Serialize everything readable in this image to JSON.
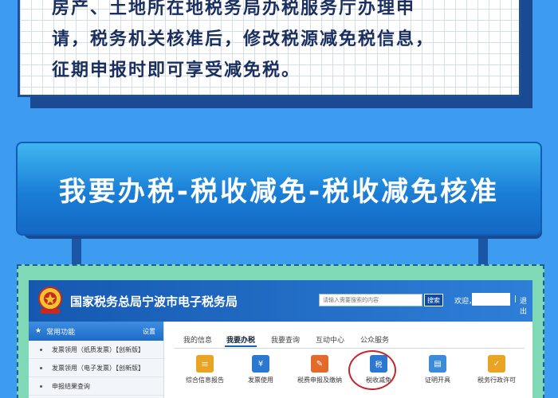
{
  "top_text": {
    "line1": "房产、土地所在地税务局办税服务厅办理申",
    "line2": "请，税务机关核准后，修改税源减免税信息，",
    "line3": "征期申报时即可享受减免税。"
  },
  "banner": {
    "title": "我要办税-税收减免-税收减免核准"
  },
  "site": {
    "title": "国家税务总局宁波市电子税务局",
    "search_placeholder": "请输入需要搜索的内容",
    "search_button": "搜索",
    "welcome": "欢迎，",
    "separator": "|",
    "logout": "退出"
  },
  "sidebar": {
    "header": "常用功能",
    "settings": "设置",
    "items": [
      "发票领用（纸质发票）【创新版】",
      "发票领用（电子发票）【创新版】",
      "申报结果查询"
    ]
  },
  "tabs": [
    "我的信息",
    "我要办税",
    "我要查询",
    "互动中心",
    "公众服务"
  ],
  "tiles": [
    {
      "label": "综合信息报告",
      "icon": "report-icon",
      "color": "#e9a423"
    },
    {
      "label": "发票使用",
      "icon": "invoice-icon",
      "color": "#2b78d0"
    },
    {
      "label": "税费申报及缴纳",
      "icon": "tax-declare-icon",
      "color": "#e46a2c"
    },
    {
      "label": "税收减免",
      "icon": "tax-relief-icon",
      "color": "#2b78d0"
    },
    {
      "label": "证明开具",
      "icon": "certificate-icon",
      "color": "#3a8bd8"
    },
    {
      "label": "税务行政许可",
      "icon": "permit-icon",
      "color": "#e9a423"
    }
  ]
}
